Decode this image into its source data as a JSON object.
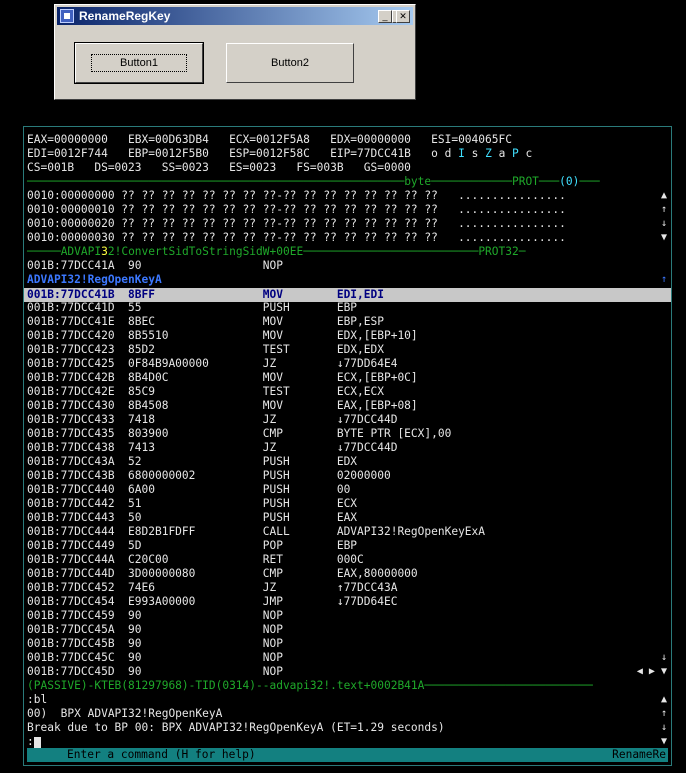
{
  "dialog": {
    "title": "RenameRegKey",
    "button1": "Button1",
    "button2": "Button2"
  },
  "registers": [
    "EAX=00000000   EBX=00D63DB4   ECX=0012F5A8   EDX=00000000   ESI=004065FC",
    "EDI=0012F744   EBP=0012F5B0   ESP=0012F58C   EIP=77DCC41B   ",
    "CS=001B   DS=0023   SS=0023   ES=0023   FS=003B   GS=0000"
  ],
  "flags": [
    {
      "t": "o",
      "h": false
    },
    {
      "t": "d",
      "h": false
    },
    {
      "t": "I",
      "h": true
    },
    {
      "t": "s",
      "h": false
    },
    {
      "t": "Z",
      "h": true
    },
    {
      "t": "a",
      "h": false
    },
    {
      "t": "P",
      "h": true
    },
    {
      "t": "c",
      "h": false
    }
  ],
  "data_sep": {
    "label": "byte",
    "prot": "PROT",
    "num": "(0)"
  },
  "data_rows": [
    {
      "addr": "0010:00000000",
      "bytes": "?? ?? ?? ?? ?? ?? ?? ??-?? ?? ?? ?? ?? ?? ?? ??",
      "ascii": "................"
    },
    {
      "addr": "0010:00000010",
      "bytes": "?? ?? ?? ?? ?? ?? ?? ??-?? ?? ?? ?? ?? ?? ?? ??",
      "ascii": "................"
    },
    {
      "addr": "0010:00000020",
      "bytes": "?? ?? ?? ?? ?? ?? ?? ??-?? ?? ?? ?? ?? ?? ?? ??",
      "ascii": "................"
    },
    {
      "addr": "0010:00000030",
      "bytes": "?? ?? ?? ?? ?? ?? ?? ??-?? ?? ?? ?? ?? ?? ?? ??",
      "ascii": "................"
    }
  ],
  "code_sep": {
    "pre": "ADVAPI",
    "hl": "3",
    "post": "2!ConvertSidToStringSidW+00EE",
    "prot": "PROT32"
  },
  "pre_line": {
    "addr": "001B:77DCC41A",
    "bytes": "90",
    "mn": "NOP",
    "op": ""
  },
  "func_header": "ADVAPI32!RegOpenKeyA",
  "current": {
    "addr": "001B:77DCC41B",
    "bytes": "8BFF",
    "mn": "MOV",
    "op": "EDI,EDI"
  },
  "code": [
    {
      "addr": "001B:77DCC41D",
      "bytes": "55",
      "mn": "PUSH",
      "op": "EBP"
    },
    {
      "addr": "001B:77DCC41E",
      "bytes": "8BEC",
      "mn": "MOV",
      "op": "EBP,ESP"
    },
    {
      "addr": "001B:77DCC420",
      "bytes": "8B5510",
      "mn": "MOV",
      "op": "EDX,[EBP+10]"
    },
    {
      "addr": "001B:77DCC423",
      "bytes": "85D2",
      "mn": "TEST",
      "op": "EDX,EDX"
    },
    {
      "addr": "001B:77DCC425",
      "bytes": "0F84B9A00000",
      "mn": "JZ",
      "op": "↓77DD64E4"
    },
    {
      "addr": "001B:77DCC42B",
      "bytes": "8B4D0C",
      "mn": "MOV",
      "op": "ECX,[EBP+0C]"
    },
    {
      "addr": "001B:77DCC42E",
      "bytes": "85C9",
      "mn": "TEST",
      "op": "ECX,ECX"
    },
    {
      "addr": "001B:77DCC430",
      "bytes": "8B4508",
      "mn": "MOV",
      "op": "EAX,[EBP+08]"
    },
    {
      "addr": "001B:77DCC433",
      "bytes": "7418",
      "mn": "JZ",
      "op": "↓77DCC44D"
    },
    {
      "addr": "001B:77DCC435",
      "bytes": "803900",
      "mn": "CMP",
      "op": "BYTE PTR [ECX],00"
    },
    {
      "addr": "001B:77DCC438",
      "bytes": "7413",
      "mn": "JZ",
      "op": "↓77DCC44D"
    },
    {
      "addr": "001B:77DCC43A",
      "bytes": "52",
      "mn": "PUSH",
      "op": "EDX"
    },
    {
      "addr": "001B:77DCC43B",
      "bytes": "6800000002",
      "mn": "PUSH",
      "op": "02000000"
    },
    {
      "addr": "001B:77DCC440",
      "bytes": "6A00",
      "mn": "PUSH",
      "op": "00"
    },
    {
      "addr": "001B:77DCC442",
      "bytes": "51",
      "mn": "PUSH",
      "op": "ECX"
    },
    {
      "addr": "001B:77DCC443",
      "bytes": "50",
      "mn": "PUSH",
      "op": "EAX"
    },
    {
      "addr": "001B:77DCC444",
      "bytes": "E8D2B1FDFF",
      "mn": "CALL",
      "op": "ADVAPI32!RegOpenKeyExA"
    },
    {
      "addr": "001B:77DCC449",
      "bytes": "5D",
      "mn": "POP",
      "op": "EBP"
    },
    {
      "addr": "001B:77DCC44A",
      "bytes": "C20C00",
      "mn": "RET",
      "op": "000C"
    },
    {
      "addr": "001B:77DCC44D",
      "bytes": "3D00000080",
      "mn": "CMP",
      "op": "EAX,80000000"
    },
    {
      "addr": "001B:77DCC452",
      "bytes": "74E6",
      "mn": "JZ",
      "op": "↑77DCC43A"
    },
    {
      "addr": "001B:77DCC454",
      "bytes": "E993A00000",
      "mn": "JMP",
      "op": "↓77DD64EC"
    },
    {
      "addr": "001B:77DCC459",
      "bytes": "90",
      "mn": "NOP",
      "op": ""
    },
    {
      "addr": "001B:77DCC45A",
      "bytes": "90",
      "mn": "NOP",
      "op": ""
    },
    {
      "addr": "001B:77DCC45B",
      "bytes": "90",
      "mn": "NOP",
      "op": ""
    },
    {
      "addr": "001B:77DCC45C",
      "bytes": "90",
      "mn": "NOP",
      "op": ""
    },
    {
      "addr": "001B:77DCC45D",
      "bytes": "90",
      "mn": "NOP",
      "op": ""
    }
  ],
  "thread_sep": "(PASSIVE)-KTEB(81297968)-TID(0314)--advapi32!.text+0002B41A",
  "command_lines": [
    ":bl",
    "00)  BPX ADVAPI32!RegOpenKeyA",
    "Break due to BP 00: BPX ADVAPI32!RegOpenKeyA (ET=1.29 seconds)"
  ],
  "prompt": ":",
  "status": {
    "hint": "Enter a command (H for help)",
    "module": "RenameRe"
  },
  "icons": [
    "app-icon",
    "minimize-icon",
    "maximize-icon",
    "close-icon",
    "scroll-up-icon",
    "scroll-down-icon",
    "scroll-left-icon",
    "scroll-right-icon"
  ]
}
